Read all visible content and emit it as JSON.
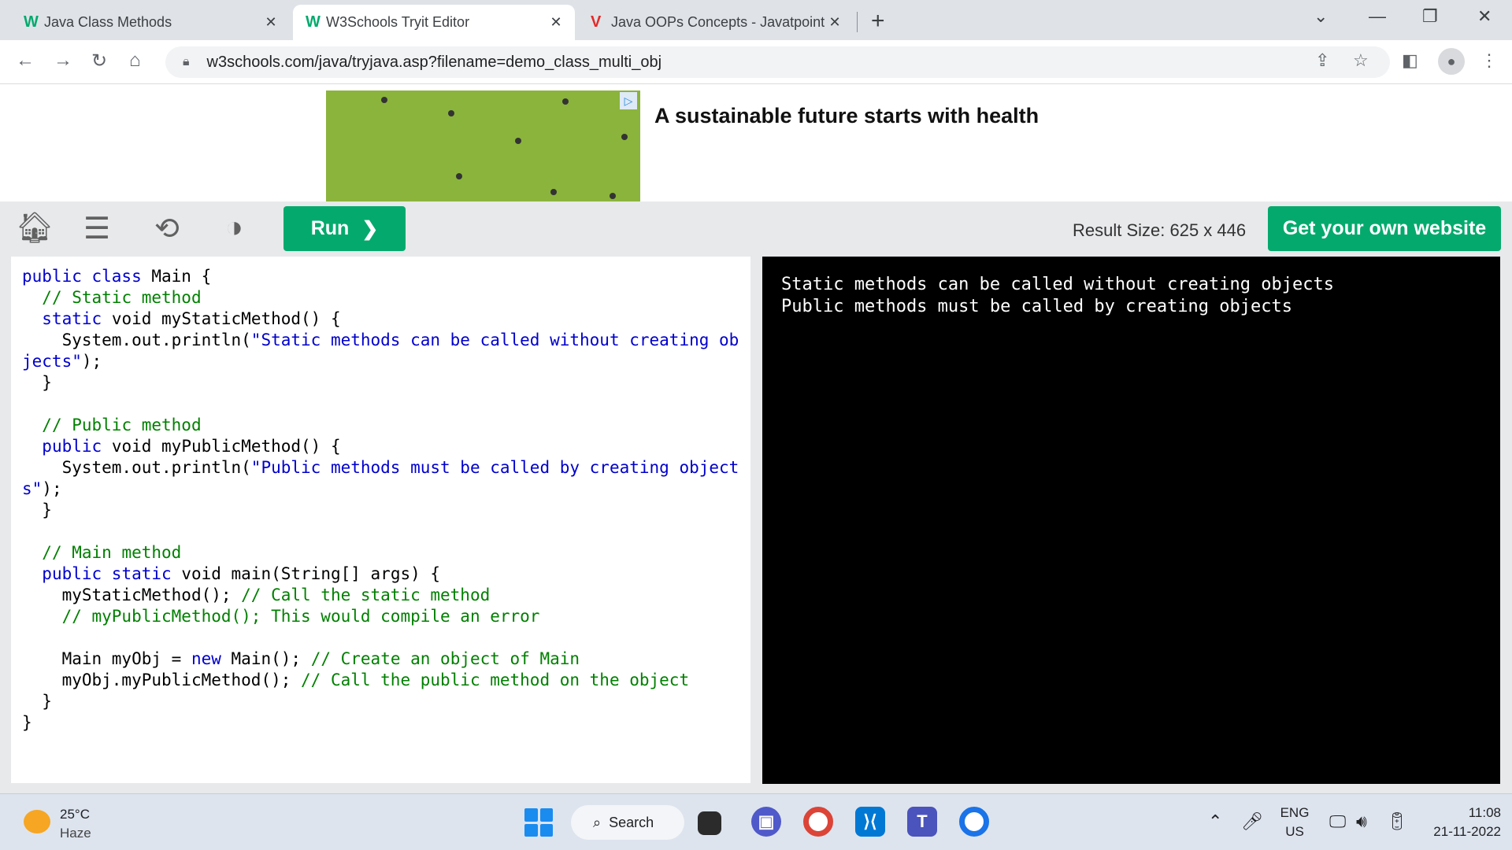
{
  "browser": {
    "tabs": [
      {
        "favicon": "w3schools-icon",
        "favicon_glyph": "W",
        "title": "Java Class Methods",
        "active": false
      },
      {
        "favicon": "w3schools-icon",
        "favicon_glyph": "W",
        "title": "W3Schools Tryit Editor",
        "active": true
      },
      {
        "favicon": "javatpoint-icon",
        "favicon_glyph": "V",
        "title": "Java OOPs Concepts - Javatpoint",
        "active": false
      }
    ],
    "close_glyph": "✕",
    "new_tab_glyph": "+",
    "url": "w3schools.com/java/tryjava.asp?filename=demo_class_multi_obj"
  },
  "ad": {
    "headline": "A sustainable future starts with health",
    "badge_glyph": "▷"
  },
  "editor_toolbar": {
    "run_label": "Run",
    "run_chevron": "❯",
    "result_size": "Result Size: 625 x 446",
    "get_website_label": "Get your own website"
  },
  "code": {
    "lines": [
      [
        {
          "t": "public class ",
          "k": "k"
        },
        {
          "t": "Main {",
          "k": "n"
        }
      ],
      [
        {
          "t": "  // Static method",
          "k": "c"
        }
      ],
      [
        {
          "t": "  static ",
          "k": "k"
        },
        {
          "t": "void myStaticMethod() {",
          "k": "n"
        }
      ],
      [
        {
          "t": "    System.out.println(",
          "k": "n"
        },
        {
          "t": "\"Static methods can be called without creating objects\"",
          "k": "s"
        },
        {
          "t": ");",
          "k": "n"
        }
      ],
      [
        {
          "t": "  }",
          "k": "n"
        }
      ],
      [
        {
          "t": "",
          "k": "n"
        }
      ],
      [
        {
          "t": "  // Public method",
          "k": "c"
        }
      ],
      [
        {
          "t": "  public ",
          "k": "k"
        },
        {
          "t": "void myPublicMethod() {",
          "k": "n"
        }
      ],
      [
        {
          "t": "    System.out.println(",
          "k": "n"
        },
        {
          "t": "\"Public methods must be called by creating objects\"",
          "k": "s"
        },
        {
          "t": ");",
          "k": "n"
        }
      ],
      [
        {
          "t": "  }",
          "k": "n"
        }
      ],
      [
        {
          "t": "",
          "k": "n"
        }
      ],
      [
        {
          "t": "  // Main method",
          "k": "c"
        }
      ],
      [
        {
          "t": "  public static ",
          "k": "k"
        },
        {
          "t": "void main(String[] args) {",
          "k": "n"
        }
      ],
      [
        {
          "t": "    myStaticMethod(); ",
          "k": "n"
        },
        {
          "t": "// Call the static method",
          "k": "c"
        }
      ],
      [
        {
          "t": "    // myPublicMethod(); This would compile an error",
          "k": "c"
        }
      ],
      [
        {
          "t": "",
          "k": "n"
        }
      ],
      [
        {
          "t": "    Main myObj = ",
          "k": "n"
        },
        {
          "t": "new ",
          "k": "k"
        },
        {
          "t": "Main(); ",
          "k": "n"
        },
        {
          "t": "// Create an object of Main",
          "k": "c"
        }
      ],
      [
        {
          "t": "    myObj.myPublicMethod(); ",
          "k": "n"
        },
        {
          "t": "// Call the public method on the object",
          "k": "c"
        }
      ],
      [
        {
          "t": "  }",
          "k": "n"
        }
      ],
      [
        {
          "t": "}",
          "k": "n"
        }
      ]
    ]
  },
  "output": {
    "lines": [
      "Static methods can be called without creating objects",
      "Public methods must be called by creating objects"
    ]
  },
  "taskbar": {
    "weather_temp": "25°C",
    "weather_condition": "Haze",
    "search_label": "Search",
    "language_line1": "ENG",
    "language_line2": "US",
    "time": "11:08",
    "date": "21-11-2022"
  },
  "colors": {
    "accent_green": "#04aa6d",
    "code_keyword": "#0000cd",
    "code_comment": "#008000"
  }
}
